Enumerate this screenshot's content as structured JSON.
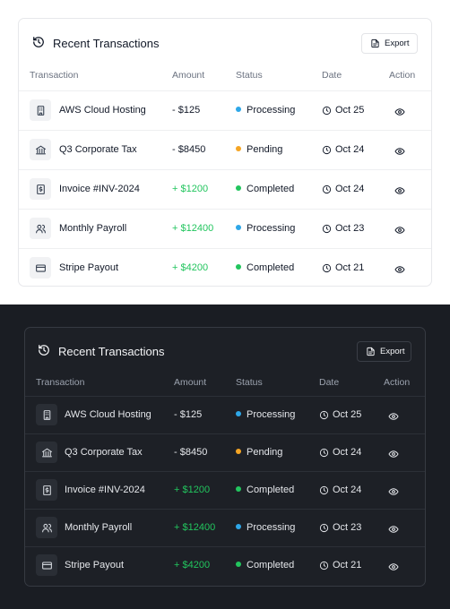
{
  "title": "Recent Transactions",
  "export_label": "Export",
  "columns": {
    "transaction": "Transaction",
    "amount": "Amount",
    "status": "Status",
    "date": "Date",
    "action": "Action"
  },
  "status_colors": {
    "Processing": "#2ea7e8",
    "Pending": "#f5a524",
    "Completed": "#22c55e"
  },
  "rows": [
    {
      "icon": "building-icon",
      "name": "AWS Cloud Hosting",
      "amount": "- $125",
      "direction": "out",
      "status": "Processing",
      "date": "Oct 25"
    },
    {
      "icon": "bank-icon",
      "name": "Q3 Corporate Tax",
      "amount": "- $8450",
      "direction": "out",
      "status": "Pending",
      "date": "Oct 24"
    },
    {
      "icon": "invoice-icon",
      "name": "Invoice #INV-2024",
      "amount": "+ $1200",
      "direction": "in",
      "status": "Completed",
      "date": "Oct 24"
    },
    {
      "icon": "users-icon",
      "name": "Monthly Payroll",
      "amount": "+ $12400",
      "direction": "in",
      "status": "Processing",
      "date": "Oct 23"
    },
    {
      "icon": "credit-card-icon",
      "name": "Stripe Payout",
      "amount": "+ $4200",
      "direction": "in",
      "status": "Completed",
      "date": "Oct 21"
    }
  ]
}
